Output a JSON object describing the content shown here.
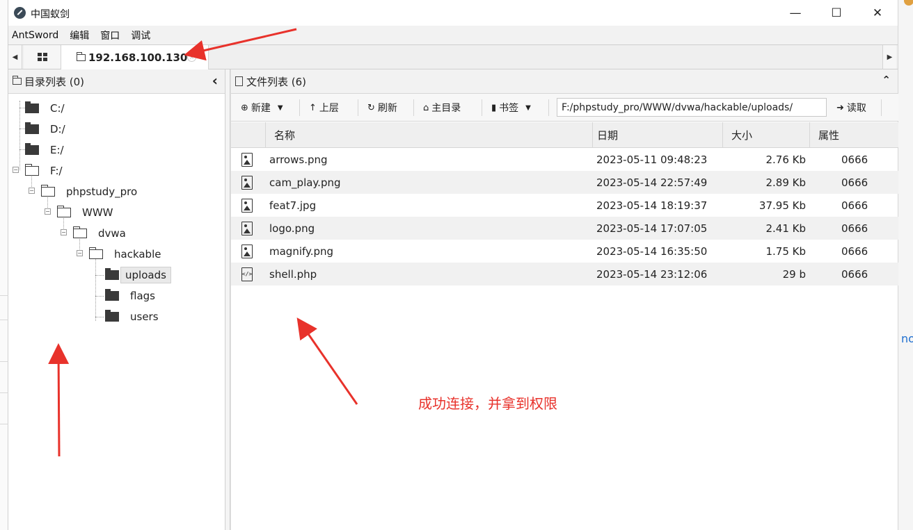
{
  "window": {
    "title": "中国蚁剑",
    "controls": {
      "minimize": "—",
      "maximize": "☐",
      "close": "✕"
    }
  },
  "menu": [
    "AntSword",
    "编辑",
    "窗口",
    "调试"
  ],
  "tabs": {
    "active_label": "192.168.100.130",
    "scroll_left": "◀",
    "scroll_right": "▶",
    "close_glyph": "×"
  },
  "directory_panel": {
    "title": "目录列表 (0)",
    "collapse_glyph": "‹",
    "tree": [
      {
        "label": "C:/"
      },
      {
        "label": "D:/"
      },
      {
        "label": "E:/"
      },
      {
        "label": "F:/"
      },
      {
        "label": "phpstudy_pro"
      },
      {
        "label": "WWW"
      },
      {
        "label": "dvwa"
      },
      {
        "label": "hackable"
      },
      {
        "label": "uploads"
      },
      {
        "label": "flags"
      },
      {
        "label": "users"
      }
    ],
    "selected": "uploads"
  },
  "file_panel": {
    "title": "文件列表 (6)",
    "collapse_glyph": "⌃",
    "toolbar": {
      "new_label": "新建",
      "up_label": "上层",
      "refresh_label": "刷新",
      "home_label": "主目录",
      "bookmark_label": "书签",
      "path_value": "F:/phpstudy_pro/WWW/dvwa/hackable/uploads/",
      "read_label": "读取"
    },
    "columns": [
      "名称",
      "日期",
      "大小",
      "属性"
    ],
    "rows": [
      {
        "icon": "image-file-icon",
        "name": "arrows.png",
        "date": "2023-05-11 09:48:23",
        "size": "2.76 Kb",
        "perm": "0666"
      },
      {
        "icon": "image-file-icon",
        "name": "cam_play.png",
        "date": "2023-05-14 22:57:49",
        "size": "2.89 Kb",
        "perm": "0666"
      },
      {
        "icon": "image-file-icon",
        "name": "feat7.jpg",
        "date": "2023-05-14 18:19:37",
        "size": "37.95 Kb",
        "perm": "0666"
      },
      {
        "icon": "image-file-icon",
        "name": "logo.png",
        "date": "2023-05-14 17:07:05",
        "size": "2.41 Kb",
        "perm": "0666"
      },
      {
        "icon": "image-file-icon",
        "name": "magnify.png",
        "date": "2023-05-14 16:35:50",
        "size": "1.75 Kb",
        "perm": "0666"
      },
      {
        "icon": "code-file-icon",
        "name": "shell.php",
        "date": "2023-05-14 23:12:06",
        "size": "29 b",
        "perm": "0666"
      }
    ]
  },
  "annotation": {
    "text": "成功连接，并拿到权限",
    "color": "#e8322b"
  },
  "background": {
    "right_edge_text": "no"
  }
}
